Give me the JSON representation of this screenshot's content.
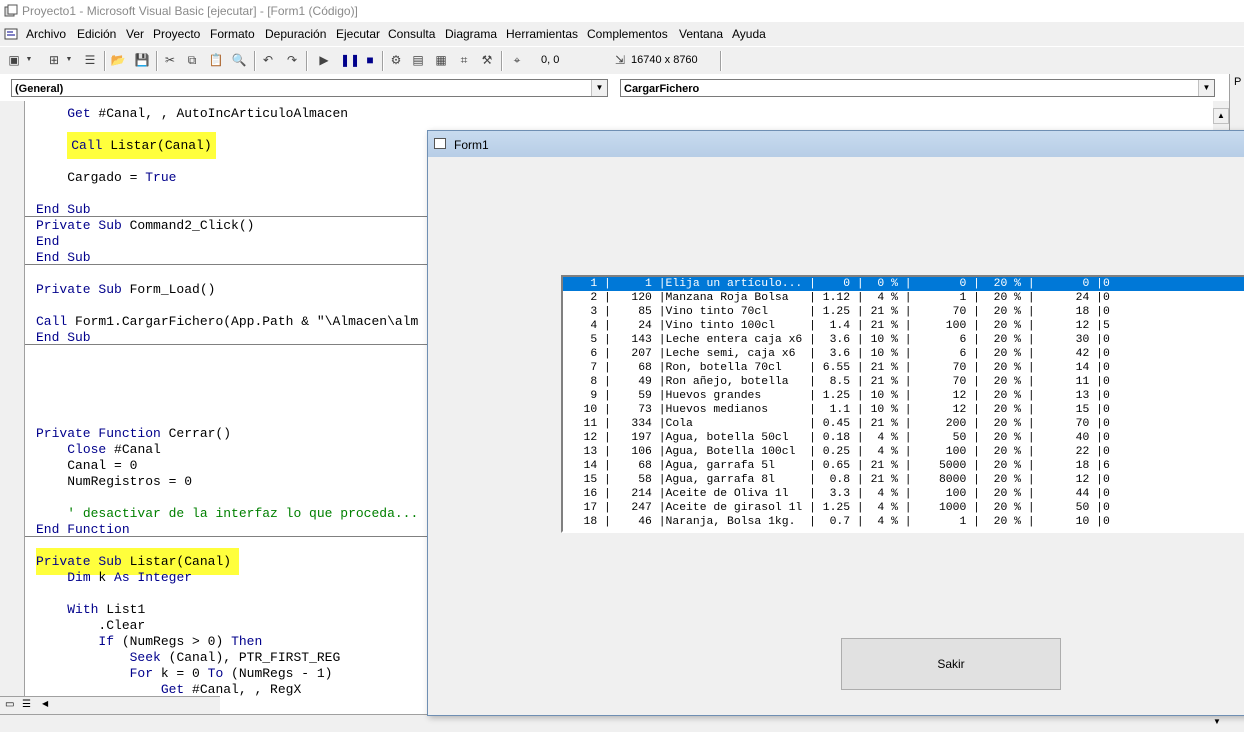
{
  "window": {
    "title": "Proyecto1 - Microsoft Visual Basic [ejecutar] - [Form1 (Código)]"
  },
  "menu": [
    "Archivo",
    "Edición",
    "Ver",
    "Proyecto",
    "Formato",
    "Depuración",
    "Ejecutar",
    "Consulta",
    "Diagrama",
    "Herramientas",
    "Complementos",
    "Ventana",
    "Ayuda"
  ],
  "toolbar": {
    "position": "0, 0",
    "size": "16740 x 8760"
  },
  "code_window": {
    "object_combo": "(General)",
    "proc_combo": "CargarFichero",
    "lines": [
      "    Get #Canal, , AutoIncArticuloAlmacen",
      "",
      "    Call Listar(Canal)",
      "",
      "    Cargado = True",
      "",
      "End Sub",
      "Private Sub Command2_Click()",
      "End",
      "End Sub",
      "",
      "Private Sub Form_Load()",
      "",
      "Call Form1.CargarFichero(App.Path & \"\\Almacen\\alm",
      "End Sub",
      "",
      "",
      "",
      "",
      "",
      "Private Function Cerrar()",
      "    Close #Canal",
      "    Canal = 0",
      "    NumRegistros = 0",
      "",
      "    ' desactivar de la interfaz lo que proceda...",
      "End Function",
      "",
      "Private Sub Listar(Canal)",
      "    Dim k As Integer",
      "",
      "    With List1",
      "        .Clear",
      "        If (NumRegs > 0) Then",
      "            Seek (Canal), PTR_FIRST_REG",
      "            For k = 0 To (NumRegs - 1)",
      "                Get #Canal, , RegX"
    ]
  },
  "form1": {
    "title": "Form1",
    "salir_label": "Sakir",
    "list_rows": [
      "    1 |     1 |Elija un artículo... |    0 |  0 % |       0 |  20 % |       0 |0",
      "    2 |   120 |Manzana Roja Bolsa   | 1.12 |  4 % |       1 |  20 % |      24 |0",
      "    3 |    85 |Vino tinto 70cl      | 1.25 | 21 % |      70 |  20 % |      18 |0",
      "    4 |    24 |Vino tinto 100cl     |  1.4 | 21 % |     100 |  20 % |      12 |5",
      "    5 |   143 |Leche entera caja x6 |  3.6 | 10 % |       6 |  20 % |      30 |0",
      "    6 |   207 |Leche semi, caja x6  |  3.6 | 10 % |       6 |  20 % |      42 |0",
      "    7 |    68 |Ron, botella 70cl    | 6.55 | 21 % |      70 |  20 % |      14 |0",
      "    8 |    49 |Ron añejo, botella   |  8.5 | 21 % |      70 |  20 % |      11 |0",
      "    9 |    59 |Huevos grandes       | 1.25 | 10 % |      12 |  20 % |      13 |0",
      "   10 |    73 |Huevos medianos      |  1.1 | 10 % |      12 |  20 % |      15 |0",
      "   11 |   334 |Cola                 | 0.45 | 21 % |     200 |  20 % |      70 |0",
      "   12 |   197 |Agua, botella 50cl   | 0.18 |  4 % |      50 |  20 % |      40 |0",
      "   13 |   106 |Agua, Botella 100cl  | 0.25 |  4 % |     100 |  20 % |      22 |0",
      "   14 |    68 |Agua, garrafa 5l     | 0.65 | 21 % |    5000 |  20 % |      18 |6",
      "   15 |    58 |Agua, garrafa 8l     |  0.8 | 21 % |    8000 |  20 % |      12 |0",
      "   16 |   214 |Aceite de Oliva 1l   |  3.3 |  4 % |     100 |  20 % |      44 |0",
      "   17 |   247 |Aceite de girasol 1l | 1.25 |  4 % |    1000 |  20 % |      50 |0",
      "   18 |    46 |Naranja, Bolsa 1kg.  |  0.7 |  4 % |       1 |  20 % |      10 |0"
    ]
  }
}
